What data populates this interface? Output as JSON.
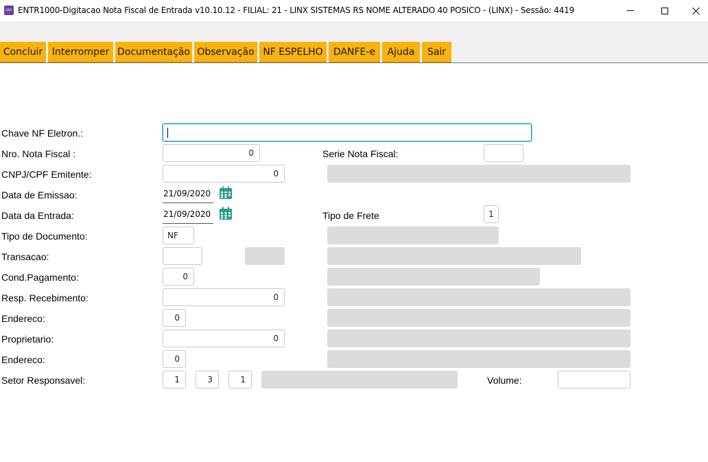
{
  "window": {
    "title": "ENTR1000-Digitacao Nota Fiscal de Entrada v10.10.12   - FILIAL: 21 - LINX SISTEMAS RS NOME ALTERADO 40 POSICO - (LINX) - Sessão: 4419",
    "icon_text": "LINX"
  },
  "menu": {
    "concluir": "Concluir",
    "interromper": "Interromper",
    "documentacao": "Documentação",
    "observacao": "Observação",
    "nf_espelho": "NF ESPELHO",
    "danfe": "DANFE-e",
    "ajuda": "Ajuda",
    "sair": "Sair"
  },
  "form": {
    "chave_label": "Chave NF Eletron.:",
    "chave_value": "",
    "nro_label": "Nro. Nota Fiscal :",
    "nro_value": "0",
    "serie_label": "Serie Nota Fiscal:",
    "serie_value": "",
    "cnpj_label": "CNPJ/CPF Emitente:",
    "cnpj_value": "0",
    "emissao_label": "Data de Emissao:",
    "emissao_value": "21/09/2020",
    "entrada_label": "Data da Entrada:",
    "entrada_value": "21/09/2020",
    "frete_label": "Tipo de Frete",
    "frete_value": "1",
    "tipo_doc_label": "Tipo de Documento:",
    "tipo_doc_value": "NF",
    "transacao_label": "Transacao:",
    "transacao_value": "",
    "cond_pag_label": "Cond.Pagamento:",
    "cond_pag_value": "0",
    "resp_label": "Resp. Recebimento:",
    "resp_value": "0",
    "endereco1_label": "Endereco:",
    "endereco1_value": "0",
    "proprietario_label": "Proprietario:",
    "proprietario_value": "0",
    "endereco2_label": "Endereco:",
    "endereco2_value": "0",
    "setor_label": "Setor Responsavel:",
    "setor_value1": "1",
    "setor_value2": "3",
    "setor_value3": "1",
    "volume_label": "Volume:",
    "volume_value": ""
  },
  "colors": {
    "menu_button": "#f9b20f",
    "readonly_field": "#dcdcdc",
    "focus_border": "#1e9ad6",
    "calendar_icon": "#2a9d8f"
  }
}
